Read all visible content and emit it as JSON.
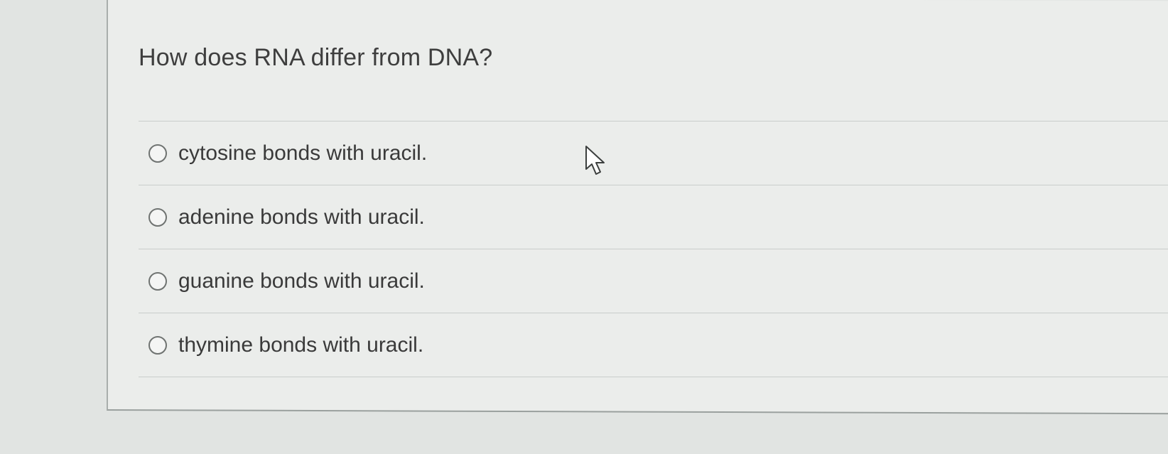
{
  "question": {
    "text": "How does RNA differ from DNA?"
  },
  "options": [
    {
      "label": "cytosine bonds with uracil."
    },
    {
      "label": "adenine bonds with uracil."
    },
    {
      "label": "guanine bonds with uracil."
    },
    {
      "label": "thymine bonds with uracil."
    }
  ],
  "cursor": {
    "icon": "mouse-pointer-icon"
  }
}
